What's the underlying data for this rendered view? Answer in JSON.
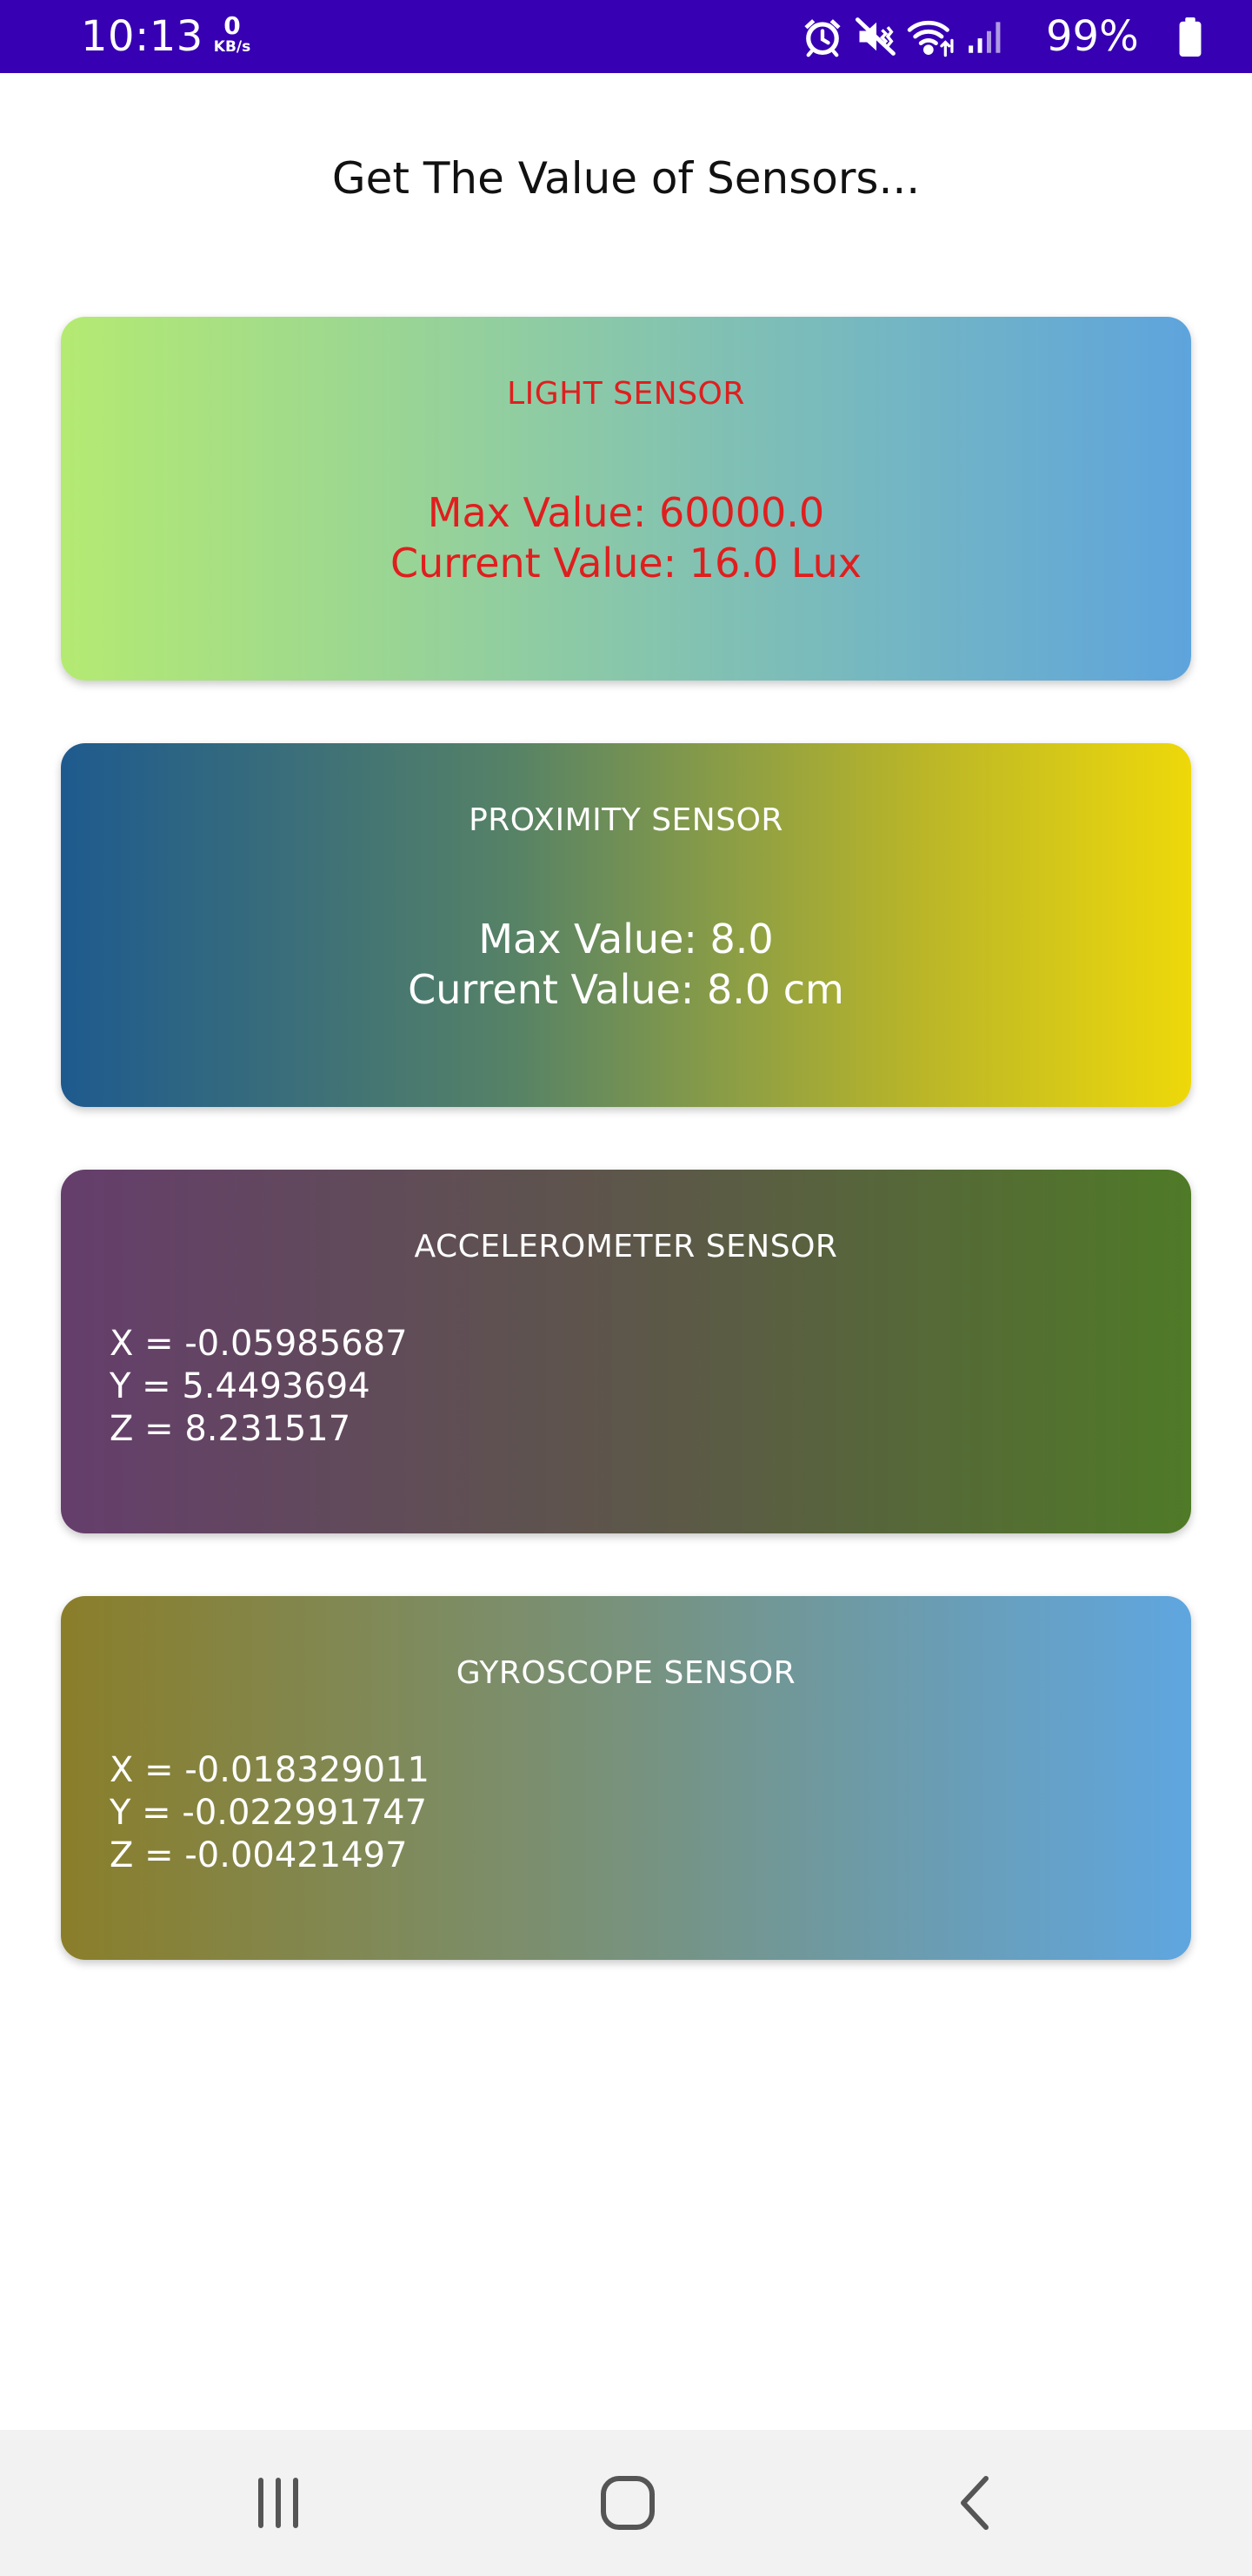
{
  "status_bar": {
    "time": "10:13",
    "network_speed_value": "0",
    "network_speed_unit": "KB/s",
    "battery_percent": "99%",
    "icons": [
      "alarm-icon",
      "mute-icon",
      "wifi-icon",
      "signal-icon",
      "battery-icon"
    ],
    "background_color": "#3700b3"
  },
  "page": {
    "title": "Get The Value of Sensors..."
  },
  "cards": {
    "light": {
      "title": "LIGHT SENSOR",
      "max_value": "Max Value: 60000.0",
      "current_value": "Current Value: 16.0 Lux",
      "text_color": "#e01e1e"
    },
    "proximity": {
      "title": "PROXIMITY SENSOR",
      "max_value": "Max Value: 8.0",
      "current_value": "Current Value: 8.0 cm"
    },
    "accelerometer": {
      "title": "ACCELEROMETER SENSOR",
      "x": "X = -0.05985687",
      "y": "Y = 5.4493694",
      "z": "Z = 8.231517"
    },
    "gyroscope": {
      "title": "GYROSCOPE SENSOR",
      "x": "X = -0.018329011",
      "y": "Y = -0.022991747",
      "z": "Z = -0.00421497"
    }
  },
  "nav_bar": {
    "buttons": [
      "recent-apps-icon",
      "home-icon",
      "back-icon"
    ]
  }
}
